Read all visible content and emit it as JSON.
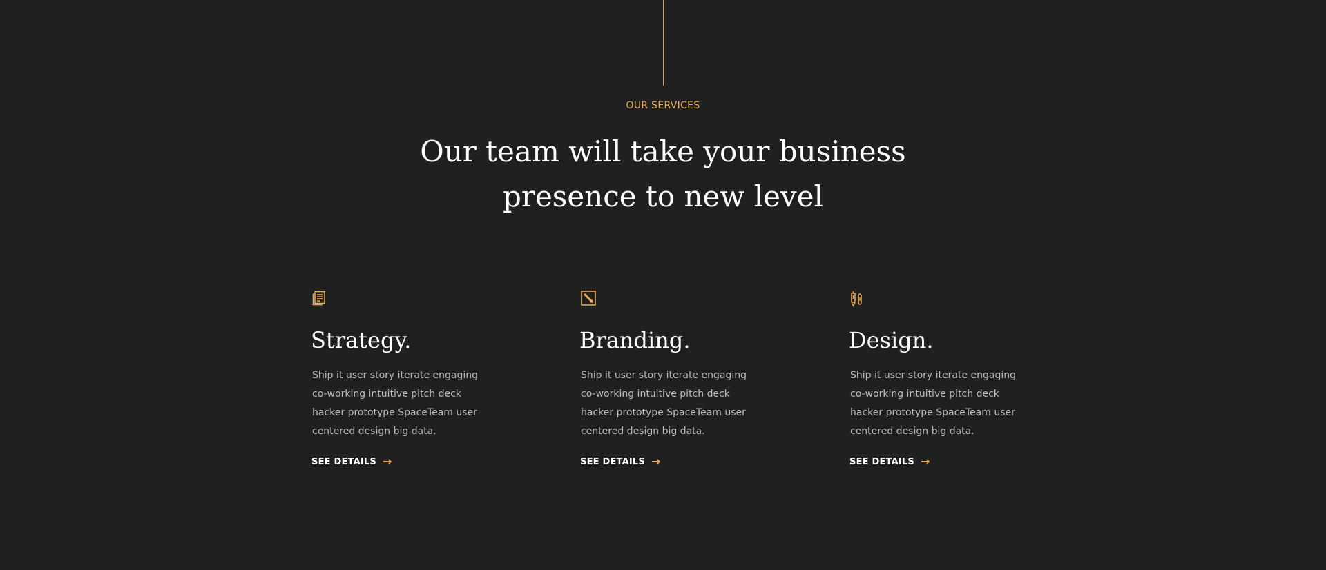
{
  "section": {
    "eyebrow": "OUR SERVICES",
    "headline": "Our team will take your business presence to new level"
  },
  "services": [
    {
      "title": "Strategy.",
      "description": "Ship it user story iterate engaging co-working intuitive pitch deck hacker prototype SpaceTeam user centered design big data.",
      "link_label": "SEE DETAILS",
      "icon": "document-icon"
    },
    {
      "title": "Branding.",
      "description": "Ship it user story iterate engaging co-working intuitive pitch deck hacker prototype SpaceTeam user centered design big data.",
      "link_label": "SEE DETAILS",
      "icon": "pencil-square-icon"
    },
    {
      "title": "Design.",
      "description": "Ship it user story iterate engaging co-working intuitive pitch deck hacker prototype SpaceTeam user centered design big data.",
      "link_label": "SEE DETAILS",
      "icon": "pen-tools-icon"
    }
  ],
  "colors": {
    "background": "#202020",
    "accent": "#f0ad55",
    "text": "#ffffff",
    "muted_text": "#bdbdbd"
  }
}
